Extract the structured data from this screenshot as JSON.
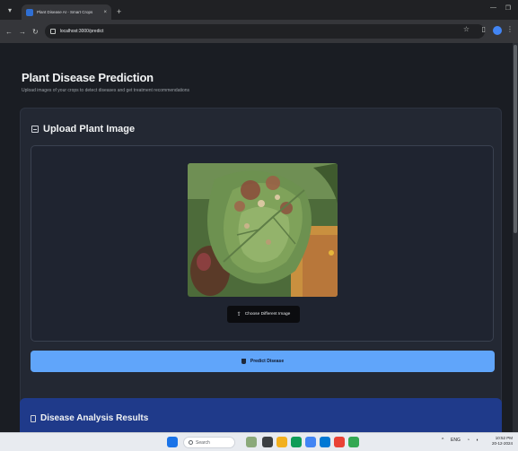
{
  "browser": {
    "tab_title": "Plant Disease AI - Smart Crops",
    "tab_close": "×",
    "new_tab": "+",
    "url": "localhost:3000/predict",
    "controls": {
      "minimize": "—",
      "maximize": "❐"
    }
  },
  "page": {
    "title": "Plant Disease Prediction",
    "subtitle": "Upload images of your crops to detect diseases and get treatment recommendations"
  },
  "upload_card": {
    "title": "Upload Plant Image",
    "choose_label": "Choose Different Image",
    "predict_label": "Predict Disease"
  },
  "results_card": {
    "title": "Disease Analysis Results"
  },
  "taskbar": {
    "search_label": "Search",
    "tray": "ENG",
    "time": "10:52 PM",
    "date": "20-12-2024"
  },
  "colors": {
    "accent": "#60a5fa",
    "results_bg": "#1f3a8a",
    "page_bg": "#1a1d23"
  }
}
